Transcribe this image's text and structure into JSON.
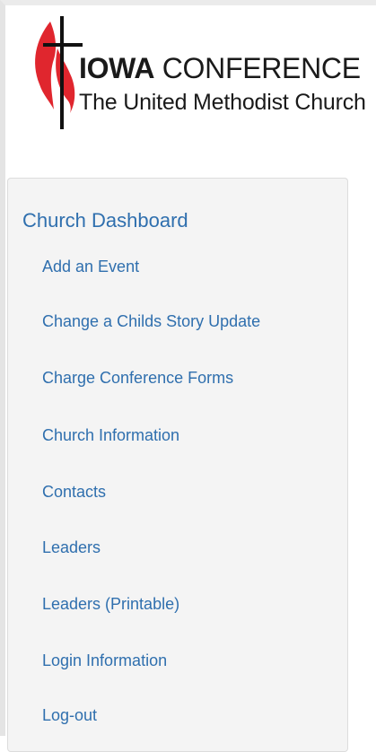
{
  "header": {
    "logo_word_bold": "IOWA",
    "logo_word_light": " CONFERENCE",
    "logo_subtitle": "The United Methodist Church",
    "logo_icon": "cross-and-flame-icon",
    "colors": {
      "flame_red": "#e0262e",
      "cross_black": "#111111"
    }
  },
  "sidebar": {
    "title": "Church Dashboard",
    "link_color": "#2f6fae",
    "items": [
      {
        "label": "Add an Event"
      },
      {
        "label": "Change a Childs Story Update"
      },
      {
        "label": "Charge Conference Forms"
      },
      {
        "label": "Church Information"
      },
      {
        "label": "Contacts"
      },
      {
        "label": "Leaders"
      },
      {
        "label": "Leaders (Printable)"
      },
      {
        "label": "Login Information"
      },
      {
        "label": "Log-out"
      }
    ]
  }
}
